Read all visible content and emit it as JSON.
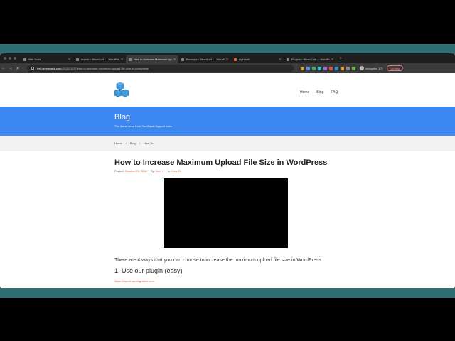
{
  "browser": {
    "tabs": [
      {
        "title": "Site Tools",
        "active": false
      },
      {
        "title": "Import ‹ SilverCod — WordPre",
        "active": false
      },
      {
        "title": "How to Increase Maximum Up",
        "active": true
      },
      {
        "title": "Backups ‹ SilverCod — WordP",
        "active": false
      },
      {
        "title": "Lightsail",
        "active": false
      },
      {
        "title": "Plugins ‹ SilverCod — WordPre",
        "active": false
      }
    ],
    "new_tab": "+",
    "url_host": "help.servmask.com",
    "url_path": "/2018/10/27/how-to-increase-maximum-upload-file-size-in-wordpress/",
    "profile_label": "Incognito (17)",
    "update_label": "Update",
    "extension_colors": [
      "#c8a13a",
      "#5b8ddc",
      "#3fae6a",
      "#36b8c9",
      "#9d6ad6",
      "#d94b4b",
      "#2f8fd8",
      "#d89a2a",
      "#8a8a8a",
      "#6ab04c"
    ]
  },
  "site": {
    "nav": [
      "Home",
      "Blog",
      "FAQ"
    ],
    "hero_title": "Blog",
    "hero_subtitle": "The latest news from ServMask Support team",
    "breadcrumbs": [
      "Home",
      "/",
      "Blog",
      "/",
      "How-To"
    ],
    "brand_color": "#3d88f0",
    "accent_color": "#d05a2a"
  },
  "post": {
    "title": "How to Increase Maximum Upload File Size in WordPress",
    "posted_label": "Posted:",
    "posted_date": "October 27, 2018",
    "by_label": "By:",
    "author": "Yani / /",
    "in_label": "In:",
    "category": "How-To",
    "intro": "There are 4 ways that you can choose to increase the maximum upload file size in WordPress.",
    "section_heading": "1. Use our plugin (easy)",
    "section_link": "https://import.wp-migration.com"
  }
}
